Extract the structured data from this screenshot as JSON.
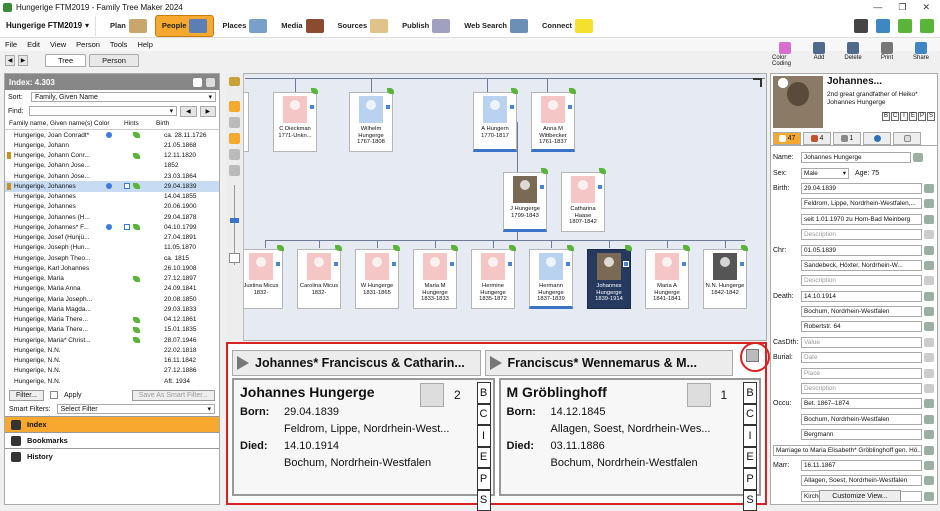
{
  "window": {
    "title": "Hungerige FTM2019 - Family Tree Maker 2024",
    "controls": [
      "—",
      "❐",
      "✕"
    ]
  },
  "ribbon": {
    "file_select": "Hungerige FTM2019",
    "nav": [
      {
        "label": "Plan",
        "color": "#c9a66b"
      },
      {
        "label": "People",
        "color": "#5b7fb5"
      },
      {
        "label": "Places",
        "color": "#79a0c8"
      },
      {
        "label": "Media",
        "color": "#8a4b2e"
      },
      {
        "label": "Sources",
        "color": "#e0c28a"
      },
      {
        "label": "Publish",
        "color": "#a0a0c0"
      },
      {
        "label": "Web Search",
        "color": "#6c8fb6"
      },
      {
        "label": "Connect",
        "color": "#f3e12e"
      }
    ]
  },
  "menubar": [
    "File",
    "Edit",
    "View",
    "Person",
    "Tools",
    "Help"
  ],
  "view_tabs": [
    "Tree",
    "Person"
  ],
  "toolbar": {
    "items": [
      {
        "label": "Color Coding",
        "color": "#d66fcf"
      },
      {
        "label": "Add",
        "color": "#506a8c"
      },
      {
        "label": "Delete",
        "color": "#506a8c"
      },
      {
        "label": "Print",
        "color": "#777777"
      },
      {
        "label": "Share",
        "color": "#3f86c4"
      }
    ]
  },
  "index": {
    "header": "Index: 4.303",
    "sort_label": "Sort:",
    "sort_value": "Family, Given Name",
    "find_label": "Find:",
    "columns": [
      "Family name, Given name(s)",
      "Color",
      "Hints",
      "Birth"
    ],
    "people": [
      {
        "name": "Hungerige, Joan Conradt*",
        "color": true,
        "hints": false,
        "leaf": true,
        "birth": "ca. 28.11.1726",
        "pin": false,
        "selected": false
      },
      {
        "name": "Hungerige, Johann",
        "color": false,
        "hints": false,
        "leaf": false,
        "birth": "21.05.1868",
        "pin": false,
        "selected": false
      },
      {
        "name": "Hungerige, Johann Conr...",
        "color": false,
        "hints": false,
        "leaf": true,
        "birth": "12.11.1820",
        "pin": true,
        "selected": false
      },
      {
        "name": "Hungerige, Johann Jose...",
        "color": false,
        "hints": false,
        "leaf": false,
        "birth": "1852",
        "pin": false,
        "selected": false
      },
      {
        "name": "Hungerige, Johann Jose...",
        "color": false,
        "hints": false,
        "leaf": false,
        "birth": "23.03.1864",
        "pin": false,
        "selected": false
      },
      {
        "name": "Hungerige, Johannes",
        "color": true,
        "hints": true,
        "leaf": true,
        "birth": "29.04.1839",
        "pin": true,
        "selected": true
      },
      {
        "name": "Hungerige, Johannes",
        "color": false,
        "hints": false,
        "leaf": false,
        "birth": "14.04.1855",
        "pin": false,
        "selected": false
      },
      {
        "name": "Hungerige, Johannes",
        "color": false,
        "hints": false,
        "leaf": false,
        "birth": "20.06.1900",
        "pin": false,
        "selected": false
      },
      {
        "name": "Hungerige, Johannes (H...",
        "color": false,
        "hints": false,
        "leaf": false,
        "birth": "29.04.1878",
        "pin": false,
        "selected": false
      },
      {
        "name": "Hungerige, Johannes* F...",
        "color": true,
        "hints": true,
        "leaf": true,
        "birth": "04.10.1799",
        "pin": false,
        "selected": false
      },
      {
        "name": "Hungerige, Josef (Hunjü...",
        "color": false,
        "hints": false,
        "leaf": false,
        "birth": "27.04.1891",
        "pin": false,
        "selected": false
      },
      {
        "name": "Hungerige, Joseph (Hun...",
        "color": false,
        "hints": false,
        "leaf": false,
        "birth": "11.05.1870",
        "pin": false,
        "selected": false
      },
      {
        "name": "Hungerige, Joseph Theo...",
        "color": false,
        "hints": false,
        "leaf": false,
        "birth": "ca. 1815",
        "pin": false,
        "selected": false
      },
      {
        "name": "Hungerige, Karl Johannes",
        "color": false,
        "hints": false,
        "leaf": false,
        "birth": "26.10.1908",
        "pin": false,
        "selected": false
      },
      {
        "name": "Hungerige, Maria",
        "color": false,
        "hints": false,
        "leaf": true,
        "birth": "27.12.1897",
        "pin": false,
        "selected": false
      },
      {
        "name": "Hungerige, Maria Anna",
        "color": false,
        "hints": false,
        "leaf": false,
        "birth": "24.09.1841",
        "pin": false,
        "selected": false
      },
      {
        "name": "Hungerige, Maria Joseph...",
        "color": false,
        "hints": false,
        "leaf": false,
        "birth": "20.08.1850",
        "pin": false,
        "selected": false
      },
      {
        "name": "Hungerige, Maria Magda...",
        "color": false,
        "hints": false,
        "leaf": false,
        "birth": "29.03.1833",
        "pin": false,
        "selected": false
      },
      {
        "name": "Hungerige, Maria There...",
        "color": false,
        "hints": false,
        "leaf": true,
        "birth": "04.12.1861",
        "pin": false,
        "selected": false
      },
      {
        "name": "Hungerige, Maria There...",
        "color": false,
        "hints": false,
        "leaf": true,
        "birth": "15.01.1835",
        "pin": false,
        "selected": false
      },
      {
        "name": "Hungerige, Maria* Christ...",
        "color": false,
        "hints": false,
        "leaf": true,
        "birth": "28.07.1946",
        "pin": false,
        "selected": false
      },
      {
        "name": "Hungerige, N.N.",
        "color": false,
        "hints": false,
        "leaf": false,
        "birth": "22.02.1818",
        "pin": false,
        "selected": false
      },
      {
        "name": "Hungerige, N.N.",
        "color": false,
        "hints": false,
        "leaf": false,
        "birth": "16.11.1842",
        "pin": false,
        "selected": false
      },
      {
        "name": "Hungerige, N.N.",
        "color": false,
        "hints": false,
        "leaf": false,
        "birth": "27.12.1886",
        "pin": false,
        "selected": false
      },
      {
        "name": "Hungerige, N.N.",
        "color": false,
        "hints": false,
        "leaf": false,
        "birth": "Aft. 1934",
        "pin": false,
        "selected": false
      }
    ],
    "filter_button": "Filter...",
    "apply_label": "Apply",
    "save_filter_button": "Save As Smart Filter...",
    "smart_filters_label": "Smart Filters:",
    "smart_filters_value": "Select Filter",
    "sections": [
      "Index",
      "Bookmarks",
      "History"
    ]
  },
  "tree": {
    "top": [
      {
        "name": "C Dieckman",
        "dates": "1771-Unkn...",
        "sex": "f"
      },
      {
        "name": "Wilhelm Hungerge",
        "dates": "1767-1808",
        "sex": "m"
      },
      {
        "name": "A Hungern",
        "dates": "1770-1817",
        "sex": "m"
      },
      {
        "name": "Anna M Wittbecker",
        "dates": "1761-1837",
        "sex": "f"
      }
    ],
    "middle": [
      {
        "name": "J Hungerge",
        "dates": "1799-1843",
        "sex": "p"
      },
      {
        "name": "Catharina Haase",
        "dates": "1807-1842",
        "sex": "f"
      }
    ],
    "bottom": [
      {
        "name": "Justina Micus",
        "dates": "1832-",
        "sex": "f"
      },
      {
        "name": "Carolina Micus",
        "dates": "1832-",
        "sex": "f"
      },
      {
        "name": "W Hungerge",
        "dates": "1831-1865",
        "sex": "f"
      },
      {
        "name": "Maria M Hungerge",
        "dates": "1833-1833",
        "sex": "f"
      },
      {
        "name": "Hermine Hungerge",
        "dates": "1835-1872",
        "sex": "f"
      },
      {
        "name": "Hermann Hungerge",
        "dates": "1837-1839",
        "sex": "m"
      },
      {
        "name": "Johannes Hungerge",
        "dates": "1839-1914",
        "sex": "p"
      },
      {
        "name": "Maria A Hungerge",
        "dates": "1841-1841",
        "sex": "f"
      },
      {
        "name": "N.N. Hungerge",
        "dates": "1842-1842",
        "sex": "g"
      }
    ]
  },
  "family": {
    "left_header": "Johannes* Franciscus & Catharin...",
    "right_header": "Franciscus* Wennemarus & M...",
    "left": {
      "name": "Johannes Hungerge",
      "count": "2",
      "born_label": "Born:",
      "born": "29.04.1839",
      "born_place": "Feldrom, Lippe, Nordrhein-West...",
      "died_label": "Died:",
      "died": "14.10.1914",
      "died_place": "Bochum, Nordrhein-Westfalen"
    },
    "right": {
      "name": "M Gröblinghoff",
      "count": "1",
      "born_label": "Born:",
      "born": "14.12.1845",
      "born_place": "Allagen, Soest, Nordrhein-Wes...",
      "died_label": "Died:",
      "died": "03.11.1886",
      "died_place": "Bochum, Nordrhein-Westfalen"
    },
    "bciep": [
      "B",
      "C",
      "I",
      "E",
      "P",
      "S"
    ]
  },
  "editor": {
    "name_title": "Johannes...",
    "relation": "2nd great grandfather of Heiko* Johannes Hungerge",
    "bciep": [
      "B",
      "C",
      "I",
      "E",
      "P",
      "S"
    ],
    "tabs": [
      {
        "label": "47"
      },
      {
        "label": "4"
      },
      {
        "label": "1"
      },
      {
        "label": ""
      },
      {
        "label": ""
      }
    ],
    "name_label": "Name:",
    "name_value": "Johannes Hungerge",
    "sex_label": "Sex:",
    "sex_value": "Male",
    "age": "Age: 75",
    "fields": [
      {
        "label": "Birth:",
        "value": "29.04.1839",
        "placeholder": false
      },
      {
        "label": "",
        "value": "Feldrom, Lippe, Nordrhein-Westfalen,...",
        "placeholder": false
      },
      {
        "label": "",
        "value": "seit 1.01.1970 zu Horn-Bad Meinberg",
        "placeholder": false
      },
      {
        "label": "",
        "value": "Description",
        "placeholder": true
      },
      {
        "label": "Chr:",
        "value": "01.05.1839",
        "placeholder": false
      },
      {
        "label": "",
        "value": "Sandebeck, Höxter, Nordrhein-W...",
        "placeholder": false
      },
      {
        "label": "",
        "value": "Description",
        "placeholder": true
      },
      {
        "label": "Death:",
        "value": "14.10.1914",
        "placeholder": false
      },
      {
        "label": "",
        "value": "Bochum, Nordrhein-Westfalen",
        "placeholder": false
      },
      {
        "label": "",
        "value": "Robertstr. 64",
        "placeholder": false
      },
      {
        "label": "CasDth:",
        "value": "Value",
        "placeholder": true
      },
      {
        "label": "Burial:",
        "value": "Date",
        "placeholder": true
      },
      {
        "label": "",
        "value": "Place",
        "placeholder": true
      },
      {
        "label": "",
        "value": "Description",
        "placeholder": true
      },
      {
        "label": "Occu:",
        "value": "Bet. 1867–1874",
        "placeholder": false
      },
      {
        "label": "",
        "value": "Bochum, Nordrhein-Westfalen",
        "placeholder": false
      },
      {
        "label": "",
        "value": "Bergmann",
        "placeholder": false
      },
      {
        "label": "",
        "value": "Marriage to Maria Elisabeth* Gröblinghoff gen. Hö...",
        "placeholder": false
      },
      {
        "label": "Marr:",
        "value": "16.11.1867",
        "placeholder": false
      },
      {
        "label": "",
        "value": "Allagen, Soest, Nordrhein-Westfalen",
        "placeholder": false
      },
      {
        "label": "",
        "value": "Kirche St. Johann Baptist",
        "placeholder": false
      }
    ],
    "customize_button": "Customize View..."
  }
}
